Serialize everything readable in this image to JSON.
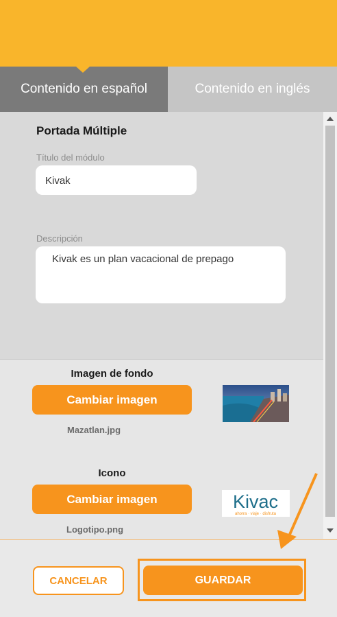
{
  "tabs": [
    {
      "label": "Contenido en español",
      "active": true
    },
    {
      "label": "Contenido en inglés",
      "active": false
    }
  ],
  "form": {
    "section_title": "Portada Múltiple",
    "title_label": "Título del módulo",
    "title_value": "Kivak",
    "description_label": "Descripción",
    "description_value": "Kivak es un plan vacacional de prepago"
  },
  "background_image": {
    "label": "Imagen de fondo",
    "button_label": "Cambiar imagen",
    "filename": "Mazatlan.jpg"
  },
  "icon_image": {
    "label": "Icono",
    "button_label": "Cambiar imagen",
    "filename": "Logotipo.png",
    "logo_text": "Kivac",
    "logo_tagline": "ahorra · viaje · disfruta"
  },
  "footer": {
    "cancel_label": "CANCELAR",
    "save_label": "GUARDAR"
  },
  "colors": {
    "header": "#f9b52b",
    "accent": "#f7941d",
    "active_tab": "#7a7a7a",
    "inactive_tab": "#c5c5c5"
  }
}
